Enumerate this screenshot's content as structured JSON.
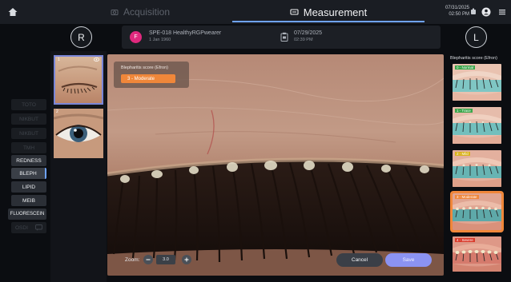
{
  "header": {
    "tabs": [
      {
        "label": "Acquisition",
        "icon": "camera-icon",
        "active": false
      },
      {
        "label": "Measurement",
        "icon": "monitor-icon",
        "active": true
      }
    ],
    "datetime": {
      "date": "07/31/2025",
      "time": "02:50 PM"
    },
    "accent_color": "#6fa3ff"
  },
  "patient": {
    "eye_right": "R",
    "eye_left": "L",
    "avatar_initial": "F",
    "name": "SPE-018 HealthyRGPwearer",
    "dob": "1 Jan 1960",
    "exam_date": "07/29/2025",
    "exam_time": "02:39 PM"
  },
  "sidebar": {
    "metrics": [
      {
        "label": "TOTO",
        "state": "disabled"
      },
      {
        "label": "NIKBUT",
        "state": "disabled"
      },
      {
        "label": "NIKBUT",
        "state": "disabled"
      },
      {
        "label": "TMH",
        "state": "disabled"
      },
      {
        "label": "REDNESS",
        "state": "enabled"
      },
      {
        "label": "BLEPH",
        "state": "selected"
      },
      {
        "label": "LIPID",
        "state": "enabled"
      },
      {
        "label": "MEIB",
        "state": "enabled"
      },
      {
        "label": "FLUORESCEIN",
        "state": "enabled"
      },
      {
        "label": "OSDI",
        "state": "disabled"
      }
    ]
  },
  "thumbnails": [
    {
      "index": "1",
      "selected": true
    },
    {
      "index": "2",
      "selected": false
    }
  ],
  "viewer": {
    "grade_title": "Blepharitis score (Efron)",
    "grade_value": "3 - Moderate",
    "zoom_label": "Zoom:",
    "zoom_value": "3.0",
    "cancel_label": "Cancel",
    "save_label": "Save",
    "accent_orange": "#f0873a",
    "save_color": "#8b93f2"
  },
  "scale": {
    "title": "Blepharitis score (Efron)",
    "grades": [
      {
        "label": "0 - Normal",
        "tag_color": "#3aa64a",
        "selected": false
      },
      {
        "label": "1 - Trace",
        "tag_color": "#3aa64a",
        "selected": false
      },
      {
        "label": "2 - Mild",
        "tag_color": "#d9b21c",
        "selected": false
      },
      {
        "label": "3 - Moderate",
        "tag_color": "#f0873a",
        "selected": true
      },
      {
        "label": "4 - Severe",
        "tag_color": "#d93a2a",
        "selected": false
      }
    ]
  }
}
